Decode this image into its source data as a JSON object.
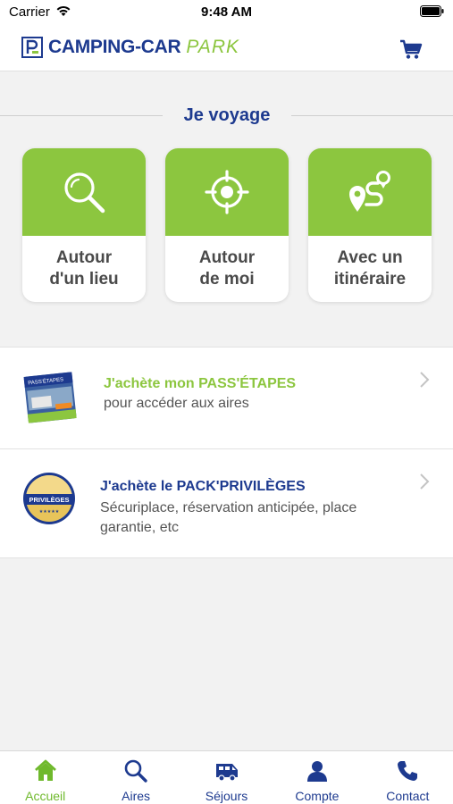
{
  "status_bar": {
    "carrier": "Carrier",
    "time": "9:48 AM"
  },
  "header": {
    "logo_main": "CAMPING-CAR",
    "logo_accent": "PARK"
  },
  "section": {
    "title": "Je voyage"
  },
  "tiles": [
    {
      "label": "Autour\nd'un lieu",
      "icon": "search-icon"
    },
    {
      "label": "Autour\nde moi",
      "icon": "locate-icon"
    },
    {
      "label": "Avec un\nitinéraire",
      "icon": "route-icon"
    }
  ],
  "offers": {
    "pass": {
      "title": "J'achète mon PASS'ÉTAPES",
      "subtitle": "pour accéder aux aires",
      "card_text": "PASS'ÉTAPES"
    },
    "pack": {
      "title": "J'achète le PACK'PRIVILÈGES",
      "subtitle": "Sécuriplace, réservation anticipée, place garantie, etc",
      "badge_text": "PRIVILÈGES"
    }
  },
  "tab_bar": {
    "active": "Accueil",
    "tabs": [
      {
        "label": "Accueil",
        "icon": "home-icon"
      },
      {
        "label": "Aires",
        "icon": "search-icon"
      },
      {
        "label": "Séjours",
        "icon": "camper-van-icon"
      },
      {
        "label": "Compte",
        "icon": "user-icon"
      },
      {
        "label": "Contact",
        "icon": "phone-icon"
      }
    ]
  },
  "colors": {
    "brand_blue": "#1d3a8f",
    "brand_green": "#8cc63f",
    "active_tab": "#6fb92c"
  }
}
